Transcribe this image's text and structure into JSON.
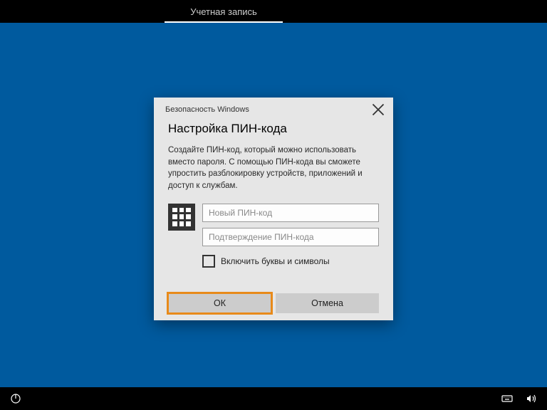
{
  "topbar": {
    "tab_account": "Учетная запись"
  },
  "dialog": {
    "window_title": "Безопасность Windows",
    "title": "Настройка ПИН-кода",
    "description": "Создайте ПИН-код, который можно использовать вместо пароля. С помощью ПИН-кода вы сможете упростить разблокировку устройств, приложений и доступ к службам.",
    "pin_placeholder": "Новый ПИН-код",
    "pin_confirm_placeholder": "Подтверждение ПИН-кода",
    "checkbox_label": "Включить буквы и символы",
    "ok_label": "ОК",
    "cancel_label": "Отмена"
  }
}
